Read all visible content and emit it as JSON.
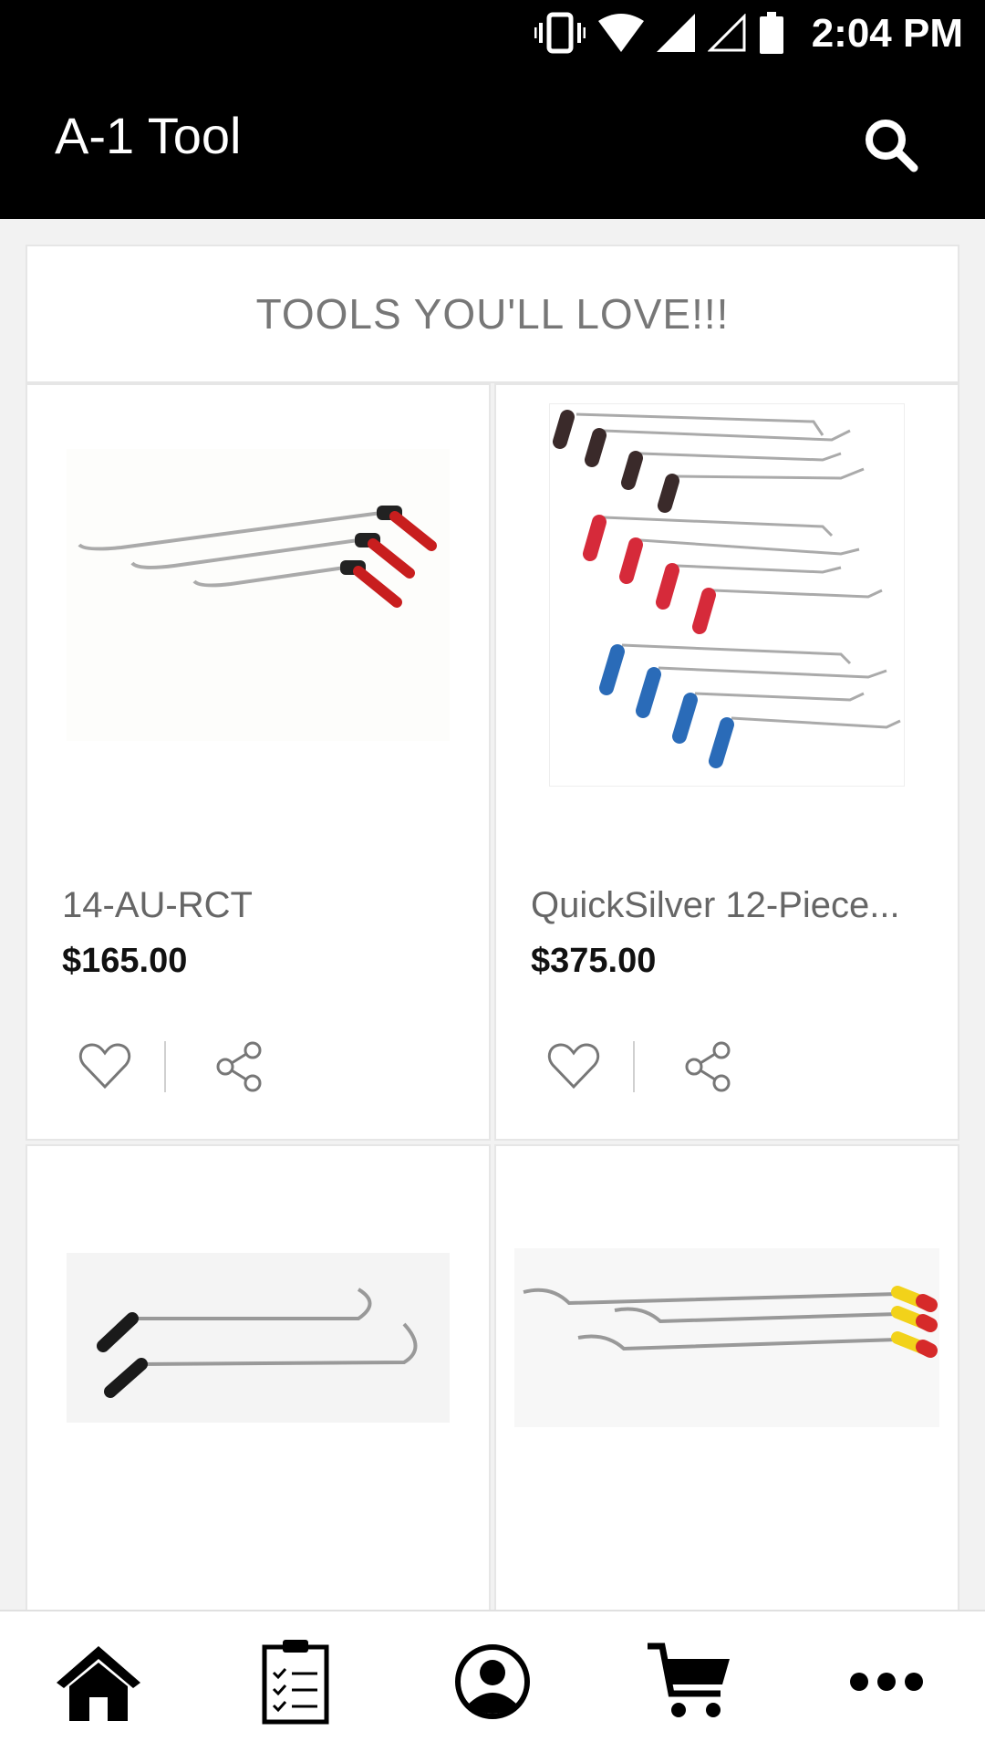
{
  "status": {
    "time": "2:04 PM"
  },
  "appbar": {
    "title": "A-1 Tool"
  },
  "section": {
    "title": "TOOLS YOU'LL LOVE!!!"
  },
  "products": [
    {
      "name": "14-AU-RCT",
      "price": "$165.00"
    },
    {
      "name": "QuickSilver 12-Piece...",
      "price": "$375.00"
    }
  ],
  "icons": {
    "search": "search-icon",
    "heart": "heart-icon",
    "share": "share-icon",
    "home": "home-icon",
    "orders": "clipboard-checklist-icon",
    "account": "account-icon",
    "cart": "cart-icon",
    "more": "more-icon"
  },
  "colors": {
    "appbar_bg": "#000000",
    "page_bg": "#f2f2f2",
    "price": "#111111",
    "name": "#666666"
  }
}
